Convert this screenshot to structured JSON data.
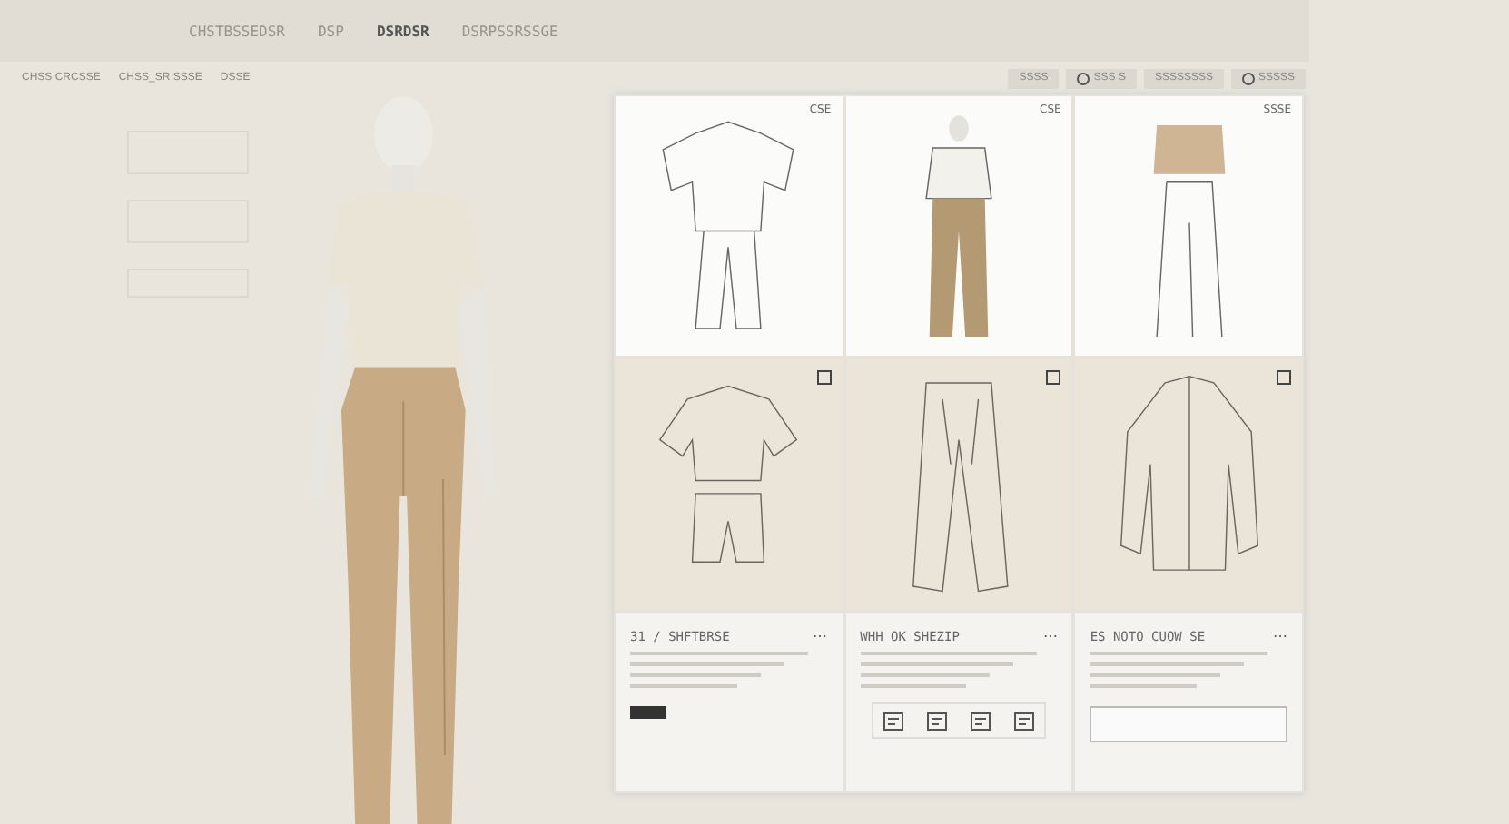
{
  "top_tabs": [
    {
      "label": "CHSTBSSEDSR",
      "selected": false
    },
    {
      "label": "DSP",
      "selected": false
    },
    {
      "label": "DSRDSR",
      "selected": true
    },
    {
      "label": "DSRPSSRSSGE",
      "selected": false
    }
  ],
  "subtabs": [
    {
      "label": "CHSS CRCSSE",
      "selected": false
    },
    {
      "label": "CHSS_SR SSSE",
      "selected": false
    },
    {
      "label": "DSSE",
      "selected": false
    }
  ],
  "toolbar_buttons": [
    {
      "kind": "text",
      "label": "SSSS"
    },
    {
      "kind": "radio",
      "label": "SSS S"
    },
    {
      "kind": "text",
      "label": "SSSSSSSS"
    },
    {
      "kind": "radio",
      "label": "SSSSS"
    }
  ],
  "gallery": [
    {
      "kind": "flat-sketch",
      "tag": "CSE"
    },
    {
      "kind": "model-photo",
      "tag": "CSE"
    },
    {
      "kind": "croquis",
      "tag": "SSSE"
    },
    {
      "kind": "top-sketch"
    },
    {
      "kind": "pants-sketch"
    },
    {
      "kind": "jacket-sketch"
    }
  ],
  "cards": [
    {
      "kind": "tag",
      "title": "31 / SHFTBRSE",
      "action": "⋯"
    },
    {
      "kind": "icons",
      "title": "WHH OK SHEZIP",
      "action": "⋯"
    },
    {
      "kind": "button",
      "title": "ES NOTO CUOW SE",
      "action": "⋯"
    }
  ]
}
